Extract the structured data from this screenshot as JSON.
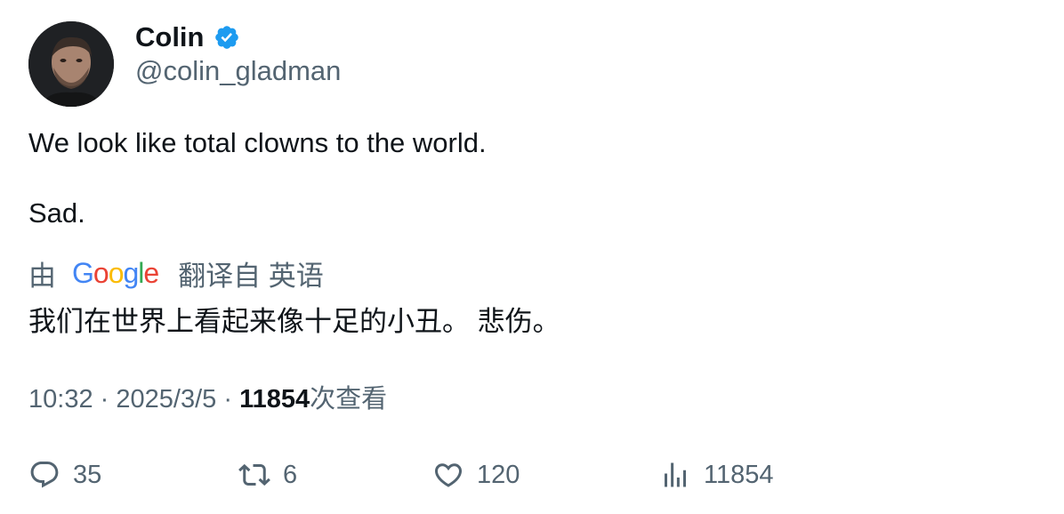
{
  "author": {
    "display_name": "Colin",
    "handle": "@colin_gladman",
    "avatar_icon": "avatar-photo",
    "verified_icon": "verified-badge-icon",
    "verified_color": "#1d9bf0"
  },
  "tweet": {
    "line1": "We look like total clowns to the world.",
    "line2": "Sad."
  },
  "translation": {
    "prefix": "由",
    "provider": "Google",
    "suffix": "翻译自 英语",
    "text": "我们在世界上看起来像十足的小丑。 悲伤。",
    "google_colors": [
      "#4285F4",
      "#EA4335",
      "#FBBC05",
      "#4285F4",
      "#34A853",
      "#EA4335"
    ]
  },
  "meta": {
    "time": "10:32",
    "date": "2025/3/5",
    "separator": "·",
    "views_count": "11854",
    "views_label": "次查看"
  },
  "actions": {
    "replies": {
      "icon": "reply-icon",
      "count": "35"
    },
    "retweets": {
      "icon": "retweet-icon",
      "count": "6"
    },
    "likes": {
      "icon": "heart-icon",
      "count": "120"
    },
    "views": {
      "icon": "views-chart-icon",
      "count": "11854"
    }
  }
}
